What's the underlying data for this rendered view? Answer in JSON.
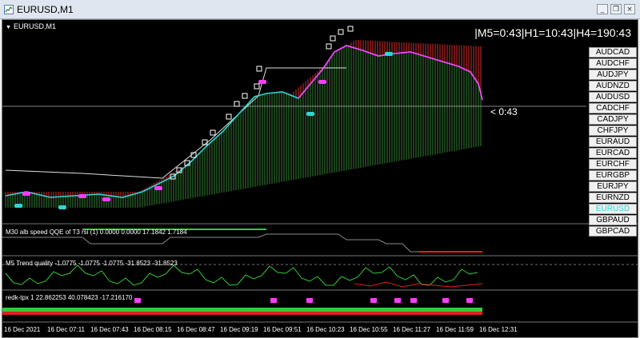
{
  "window": {
    "title": "EURUSD,M1"
  },
  "chart": {
    "symbol_label": "EURUSD,M1",
    "timer_text": "|M5=0:43|H1=10:43|H4=190:43",
    "countdown_text": "< 0:43",
    "active_pair": "EURUSD",
    "pairs": [
      "AUDCAD",
      "AUDCHF",
      "AUDJPY",
      "AUDNZD",
      "AUDUSD",
      "CADCHF",
      "CADJPY",
      "CHFJPY",
      "EURAUD",
      "EURCAD",
      "EURCHF",
      "EURGBP",
      "EURJPY",
      "EURNZD",
      "EURUSD",
      "GBPAUD",
      "GBPCAD"
    ]
  },
  "indicators": {
    "qqe_label": "M30 alb speed QQE of T3 rsi (1) 0.0000 0.0000 17.1842 1.7184",
    "trend_label": "M5 Trend quality -1.0775 -1.0775 -1.0775 -31.8523 -31.8523",
    "redk_label": "redk-tpx 1 22.862253 40.078423 -17.216170"
  },
  "time_axis": [
    "16 Dec 2021",
    "16 Dec 07:11",
    "16 Dec 07:43",
    "16 Dec 08:15",
    "16 Dec 08:47",
    "16 Dec 09:19",
    "16 Dec 09:51",
    "16 Dec 10:23",
    "16 Dec 10:55",
    "16 Dec 11:27",
    "16 Dec 11:59",
    "16 Dec 12:31"
  ],
  "colors": {
    "background": "#000000",
    "price_cyan": "#2fd6d6",
    "price_magenta": "#ff3dff",
    "cloud_red": "#7a1a1a",
    "cloud_green": "#1e4a1e",
    "trend_green": "#35c935",
    "trend_red": "#e02020",
    "qqe_gray": "#8a8a8a"
  },
  "icons": {
    "app": "chart-window-icon"
  }
}
